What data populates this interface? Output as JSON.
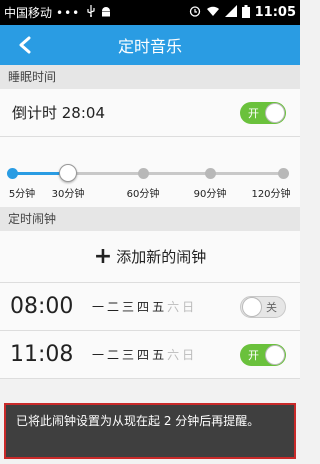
{
  "status_bar": {
    "carrier": "中国移动",
    "dots": "•••",
    "time": "11:05",
    "icons": [
      "usb-icon",
      "android-icon",
      "alarm-icon",
      "wifi-icon",
      "signal-icon",
      "battery-icon"
    ]
  },
  "header": {
    "title": "定时音乐",
    "back_icon": "chevron-left-icon"
  },
  "sleep_section": {
    "title": "睡眠时间",
    "countdown_label": "倒计时 28:04",
    "toggle_text": "开",
    "toggle_on": true
  },
  "slider": {
    "labels": [
      "5分钟",
      "30分钟",
      "60分钟",
      "90分钟",
      "120分钟"
    ],
    "selected_index": 1,
    "accent_color": "#2a9ce3"
  },
  "alarm_section": {
    "title": "定时闹钟",
    "add_label": "添加新的闹钟",
    "alarms": [
      {
        "time": "08:00",
        "days": [
          "一",
          "二",
          "三",
          "四",
          "五",
          "六",
          "日"
        ],
        "active_days": [
          true,
          true,
          true,
          true,
          true,
          false,
          false
        ],
        "toggle_text": "关",
        "enabled": false
      },
      {
        "time": "11:08",
        "days": [
          "一",
          "二",
          "三",
          "四",
          "五",
          "六",
          "日"
        ],
        "active_days": [
          true,
          true,
          true,
          true,
          true,
          false,
          false
        ],
        "toggle_text": "开",
        "enabled": true
      }
    ]
  },
  "toast": {
    "message": "已将此闹钟设置为从现在起 2 分钟后再提醒。"
  }
}
